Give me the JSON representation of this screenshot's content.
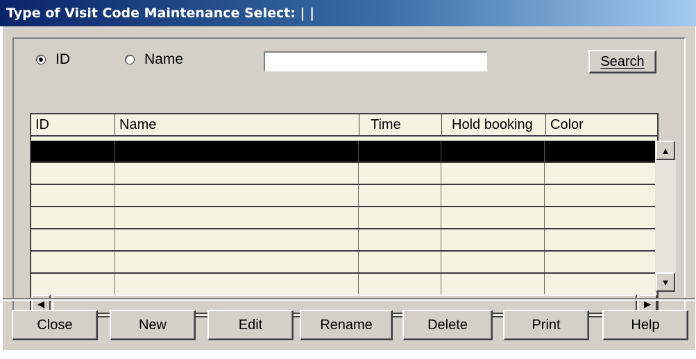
{
  "window": {
    "title": "Type of Visit Code Maintenance Select: | |"
  },
  "search": {
    "radio_id_label": "ID",
    "radio_name_label": "Name",
    "selected_option": "ID",
    "input_value": "",
    "input_placeholder": "",
    "search_button": "Search"
  },
  "grid": {
    "columns": [
      "ID",
      "Name",
      "Time",
      "Hold booking",
      "Color"
    ],
    "rows": [
      [
        "",
        "",
        "",
        "",
        ""
      ],
      [
        "",
        "",
        "",
        "",
        ""
      ],
      [
        "",
        "",
        "",
        "",
        ""
      ],
      [
        "",
        "",
        "",
        "",
        ""
      ],
      [
        "",
        "",
        "",
        "",
        ""
      ],
      [
        "",
        "",
        "",
        "",
        ""
      ],
      [
        "",
        "",
        "",
        "",
        ""
      ]
    ],
    "selected_row": 0
  },
  "footer": {
    "close": "Close",
    "new": "New",
    "edit": "Edit",
    "rename": "Rename",
    "delete": "Delete",
    "print": "Print",
    "help": "Help"
  },
  "colors": {
    "title_bar_start": "#0a246a",
    "title_bar_end": "#a6caf0",
    "dialog_bg": "#d4d0c8",
    "grid_bg": "#f4f4e2",
    "selection": "#000000"
  }
}
